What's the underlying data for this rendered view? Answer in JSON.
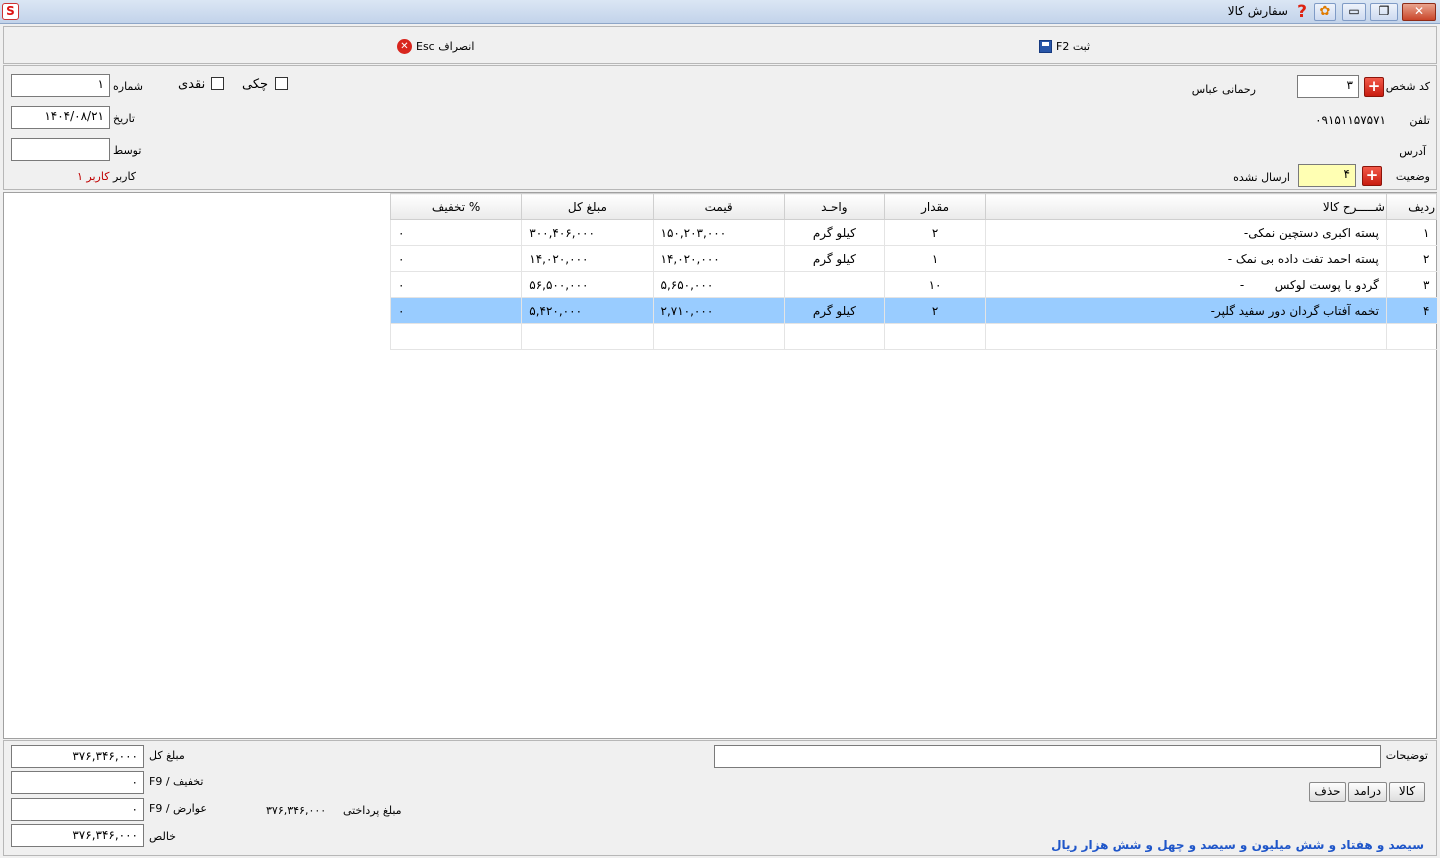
{
  "window": {
    "title": "سفارش کالا",
    "app_icon_text": "S",
    "help_glyph": "?",
    "customize_glyph": "✿",
    "minimize_glyph": "▭",
    "restore_glyph": "❐",
    "close_glyph": "✕"
  },
  "toolbar": {
    "save_label": "ثبت F2",
    "cancel_label": "انصراف Esc",
    "cancel_icon_glyph": "✕"
  },
  "header": {
    "person_code_label": "کد شخص",
    "person_code_value": "۳",
    "person_name": "رحمانی عباس",
    "phone_label": "تلفن",
    "phone_value": "۰۹۱۵۱۱۵۷۵۷۱",
    "address_label": "آدرس",
    "status_label": "وضعیت",
    "status_value": "۴",
    "status_text": "ارسال نشده",
    "check_label": "چکی",
    "cash_label": "نقدی",
    "number_label": "شماره",
    "number_value": "۱",
    "date_label": "تاریخ",
    "date_value": "۱۴۰۴/۰۸/۲۱",
    "by_label": "توسط",
    "by_value": "",
    "user_label": "کاربر",
    "user_value": "کاربر ۱",
    "plus_glyph": "+"
  },
  "table": {
    "columns": [
      "ردیف",
      "شـــــرح کالا",
      "مقدار",
      "واحـد",
      "قیمت",
      "مبلغ کل",
      "% تخفیف"
    ],
    "rows": [
      {
        "row": "۱",
        "desc": "پسته اکبری دستچین نمکی-",
        "qty": "۲",
        "unit": "کیلو گرم",
        "price": "۱۵۰,۲۰۳,۰۰۰",
        "total": "۳۰۰,۴۰۶,۰۰۰",
        "discount": "۰"
      },
      {
        "row": "۲",
        "desc": "پسته احمد تفت داده بی نمک -",
        "qty": "۱",
        "unit": "کیلو گرم",
        "price": "۱۴,۰۲۰,۰۰۰",
        "total": "۱۴,۰۲۰,۰۰۰",
        "discount": "۰"
      },
      {
        "row": "۳",
        "desc": "گردو با پوست لوکس        -",
        "qty": "۱۰",
        "unit": "",
        "price": "۵,۶۵۰,۰۰۰",
        "total": "۵۶,۵۰۰,۰۰۰",
        "discount": "۰"
      },
      {
        "row": "۴",
        "desc": "تخمه آفتاب گردان دور سفید گلپر-",
        "qty": "۲",
        "unit": "کیلو گرم",
        "price": "۲,۷۱۰,۰۰۰",
        "total": "۵,۴۲۰,۰۰۰",
        "discount": "۰"
      },
      {
        "row": "",
        "desc": "",
        "qty": "",
        "unit": "",
        "price": "",
        "total": "",
        "discount": ""
      }
    ],
    "selected_row": 4
  },
  "footer": {
    "notes_label": "توضیحات",
    "notes_value": "",
    "product_btn": "کالا",
    "income_btn": "درامد",
    "delete_btn": "حذف",
    "total_label": "مبلغ کل",
    "total_value": "۳۷۶,۳۴۶,۰۰۰",
    "discount_label": "تخفیف / F9",
    "discount_value": "۰",
    "charges_label": "عوارض / F9",
    "charges_value": "۰",
    "net_label": "خالص",
    "net_value": "۳۷۶,۳۴۶,۰۰۰",
    "payable_label": "مبلغ پرداختی",
    "payable_value": "۳۷۶,۳۴۶,۰۰۰",
    "amount_in_words": "سیصد و هفتاد و شش میلیون و سیصد و چهل و شش هزار  ریال"
  },
  "colors": {
    "selected_row": "#99ccff",
    "amount_words": "#1f56c9",
    "accent_red": "#c81c10",
    "status_field_bg": "#ffffb3"
  }
}
